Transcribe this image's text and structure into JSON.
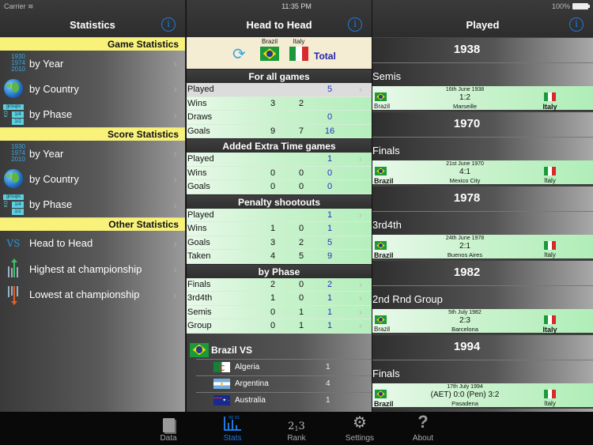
{
  "status_bar": {
    "carrier": "Carrier",
    "time": "11:35 PM",
    "battery": "100%"
  },
  "left": {
    "title": "Statistics",
    "sections": [
      {
        "header": "Game Statistics",
        "items": [
          {
            "label": "by Year",
            "icon": "years-icon",
            "icon_text": [
              "1930",
              "1974",
              "2010"
            ]
          },
          {
            "label": "by Country",
            "icon": "globe-icon"
          },
          {
            "label": "by Phase",
            "icon": "phase-icon"
          }
        ]
      },
      {
        "header": "Score Statistics",
        "items": [
          {
            "label": "by Year",
            "icon": "years-icon",
            "icon_text": [
              "1930",
              "1974",
              "2010"
            ]
          },
          {
            "label": "by Country",
            "icon": "globe-icon"
          },
          {
            "label": "by Phase",
            "icon": "phase-icon"
          }
        ]
      },
      {
        "header": "Other Statistics",
        "items": [
          {
            "label": "Head to Head",
            "icon": "vs-icon",
            "icon_text": "VS"
          },
          {
            "label": "Highest at championship",
            "icon": "arrow-up-icon"
          },
          {
            "label": "Lowest at championship",
            "icon": "arrow-down-icon"
          }
        ]
      }
    ],
    "phase_icon": {
      "groups": "groups",
      "ko": "KO",
      "quarter": "1/4",
      "semi": "1/2"
    }
  },
  "middle": {
    "title": "Head to Head",
    "team1": "Brazil",
    "team2": "Italy",
    "total_label": "Total",
    "groups": [
      {
        "title": "For all games",
        "rows": [
          {
            "label": "Played",
            "t1": "",
            "t2": "",
            "total": "5",
            "highlight": true,
            "chevron": true
          },
          {
            "label": "Wins",
            "t1": "3",
            "t2": "2",
            "total": "",
            "chevron": false
          },
          {
            "label": "Draws",
            "t1": "",
            "t2": "",
            "total": "0",
            "chevron": false
          },
          {
            "label": "Goals",
            "t1": "9",
            "t2": "7",
            "total": "16",
            "chevron": false
          }
        ]
      },
      {
        "title": "Added Extra Time games",
        "rows": [
          {
            "label": "Played",
            "t1": "",
            "t2": "",
            "total": "1",
            "chevron": true
          },
          {
            "label": "Wins",
            "t1": "0",
            "t2": "0",
            "total": "0",
            "chevron": false
          },
          {
            "label": "Goals",
            "t1": "0",
            "t2": "0",
            "total": "0",
            "chevron": false
          }
        ]
      },
      {
        "title": "Penalty shootouts",
        "rows": [
          {
            "label": "Played",
            "t1": "",
            "t2": "",
            "total": "1",
            "chevron": true
          },
          {
            "label": "Wins",
            "t1": "1",
            "t2": "0",
            "total": "1",
            "chevron": false
          },
          {
            "label": "Goals",
            "t1": "3",
            "t2": "2",
            "total": "5",
            "chevron": false
          },
          {
            "label": "Taken",
            "t1": "4",
            "t2": "5",
            "total": "9",
            "chevron": false
          }
        ]
      },
      {
        "title": "by Phase",
        "rows": [
          {
            "label": "Finals",
            "t1": "2",
            "t2": "0",
            "total": "2",
            "chevron": true
          },
          {
            "label": "3rd4th",
            "t1": "1",
            "t2": "0",
            "total": "1",
            "chevron": true
          },
          {
            "label": "Semis",
            "t1": "0",
            "t2": "1",
            "total": "1",
            "chevron": true
          },
          {
            "label": "Group",
            "t1": "0",
            "t2": "1",
            "total": "1",
            "chevron": true
          }
        ]
      }
    ],
    "vs_list": {
      "title": "Brazil VS",
      "opponents": [
        {
          "name": "Algeria",
          "count": "1",
          "flag": "dz"
        },
        {
          "name": "Argentina",
          "count": "4",
          "flag": "ar"
        },
        {
          "name": "Australia",
          "count": "1",
          "flag": "au"
        }
      ]
    }
  },
  "right": {
    "title": "Played",
    "years": [
      {
        "year": "1938",
        "phase": "Semis",
        "date": "16th June 1938",
        "score": "1:2",
        "venue": "Marseille",
        "home": "Brazil",
        "away": "Italy",
        "winner": "away"
      },
      {
        "year": "1970",
        "phase": "Finals",
        "date": "21st June 1970",
        "score": "4:1",
        "venue": "Mexico City",
        "home": "Brazil",
        "away": "Italy",
        "winner": "home"
      },
      {
        "year": "1978",
        "phase": "3rd4th",
        "date": "24th June 1978",
        "score": "2:1",
        "venue": "Buenos Aires",
        "home": "Brazil",
        "away": "Italy",
        "winner": "home"
      },
      {
        "year": "1982",
        "phase": "2nd Rnd Group",
        "date": "5th July 1982",
        "score": "2:3",
        "venue": "Barcelona",
        "home": "Brazil",
        "away": "Italy",
        "winner": "away"
      },
      {
        "year": "1994",
        "phase": "Finals",
        "date": "17th July 1994",
        "score": "(AET) 0:0 (Pen) 3:2",
        "venue": "Pasadena",
        "home": "Brazil",
        "away": "Italy",
        "winner": "home"
      }
    ]
  },
  "tabbar": {
    "tabs": [
      {
        "label": "Data",
        "icon": "data-icon",
        "active": false
      },
      {
        "label": "Stats",
        "icon": "stats-icon",
        "active": true
      },
      {
        "label": "Rank",
        "icon": "rank-icon",
        "active": false
      },
      {
        "label": "Settings",
        "icon": "settings-icon",
        "active": false
      },
      {
        "label": "About",
        "icon": "about-icon",
        "active": false
      }
    ],
    "accent": "#1e78e0"
  }
}
